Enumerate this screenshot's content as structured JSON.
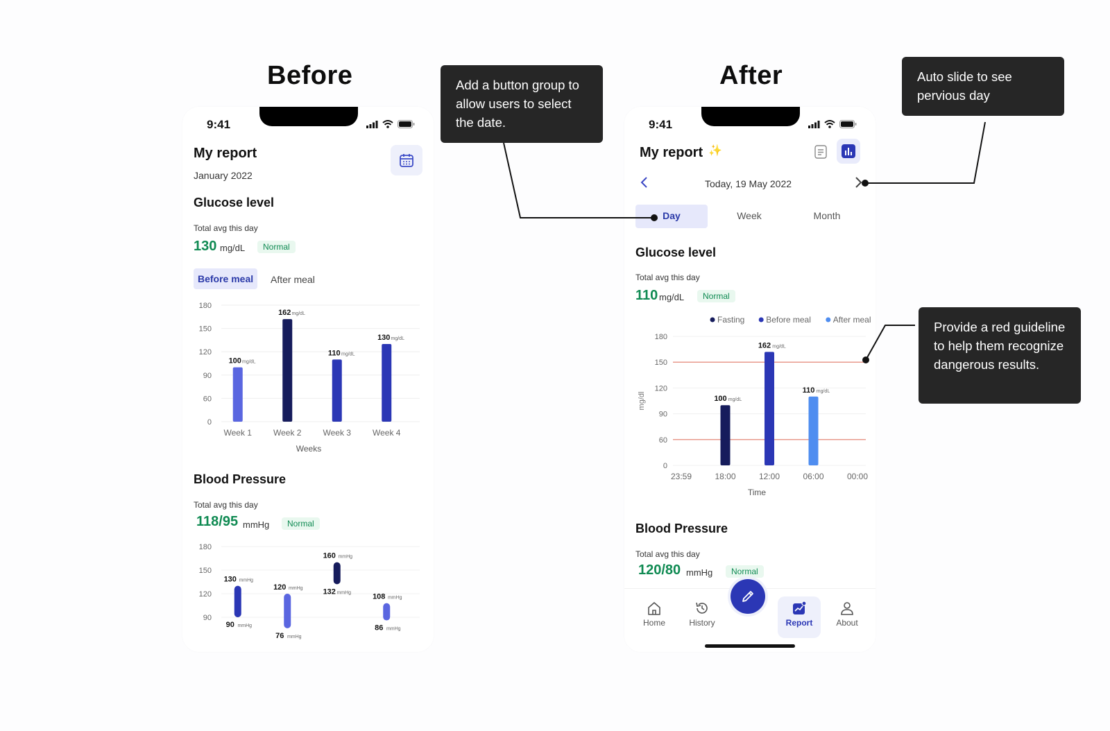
{
  "headings": {
    "before": "Before",
    "after": "After"
  },
  "callouts": {
    "date_group": "Add a button group to allow users to select the date.",
    "auto_slide": "Auto slide to see pervious day",
    "red_guideline": "Provide a red guideline to help them recognize dangerous results."
  },
  "before": {
    "status_time": "9:41",
    "title": "My report",
    "date": "January 2022",
    "glucose": {
      "title": "Glucose level",
      "avg_label": "Total avg this day",
      "value": "130",
      "unit": "mg/dL",
      "status": "Normal",
      "tabs": [
        "Before meal",
        "After meal"
      ]
    },
    "blood_pressure": {
      "title": "Blood Pressure",
      "avg_label": "Total avg this day",
      "value": "118/95",
      "unit": "mmHg",
      "status": "Normal"
    }
  },
  "after": {
    "status_time": "9:41",
    "title": "My report",
    "sparkle": "✨",
    "date_nav": {
      "label": "Today, 19 May 2022"
    },
    "segments": [
      "Day",
      "Week",
      "Month"
    ],
    "glucose": {
      "title": "Glucose level",
      "avg_label": "Total avg this day",
      "value": "110",
      "unit": "mg/dL",
      "status": "Normal"
    },
    "blood_pressure": {
      "title": "Blood Pressure",
      "avg_label": "Total avg this day",
      "value": "120/80",
      "unit": "mmHg",
      "status": "Normal"
    },
    "nav": [
      "Home",
      "History",
      "Report",
      "About"
    ]
  },
  "colors": {
    "navy": "#161c5c",
    "indigo": "#2b37b5",
    "periwinkle": "#5a66e0",
    "sky": "#4f8df0",
    "green": "#0f8a52",
    "guideline": "#e89a8c"
  },
  "chart_data": [
    {
      "type": "bar",
      "xlabel": "Weeks",
      "ylim": [
        0,
        180
      ],
      "yticks": [
        0,
        60,
        90,
        120,
        150,
        180
      ],
      "categories": [
        "Week 1",
        "Week 2",
        "Week 3",
        "Week 4"
      ],
      "values": [
        100,
        162,
        110,
        130
      ],
      "value_unit": "mg/dL",
      "bar_colors": [
        "#5a66e0",
        "#161c5c",
        "#2b37b5",
        "#2b37b5"
      ],
      "grid": true
    },
    {
      "type": "bar",
      "xlabel": "Time",
      "ylabel": "mg/dl",
      "ylim": [
        0,
        180
      ],
      "yticks": [
        0,
        60,
        90,
        120,
        150,
        180
      ],
      "categories": [
        "23:59",
        "18:00",
        "12:00",
        "06:00",
        "00:00"
      ],
      "legend": [
        "Fasting",
        "Before meal",
        "After meal"
      ],
      "legend_colors": [
        "#161c5c",
        "#2b37b5",
        "#4f8df0"
      ],
      "legend_position": "top-right",
      "bars": [
        {
          "series": "Fasting",
          "category": "18:00",
          "value": 100
        },
        {
          "series": "Before meal",
          "category": "12:00",
          "value": 162
        },
        {
          "series": "After meal",
          "category": "06:00",
          "value": 110
        }
      ],
      "value_unit": "mg/dL",
      "guidelines": [
        150,
        60
      ],
      "grid": true
    },
    {
      "type": "range-bar",
      "ylim": [
        90,
        180
      ],
      "yticks": [
        90,
        120,
        150,
        180
      ],
      "ranges": [
        {
          "high": 130,
          "low": 90
        },
        {
          "high": 120,
          "low": 76
        },
        {
          "high": 160,
          "low": 132
        },
        {
          "high": 108,
          "low": 86
        }
      ],
      "value_unit": "mmHg",
      "bar_colors": [
        "#2b37b5",
        "#5a66e0",
        "#161c5c",
        "#5a66e0"
      ]
    }
  ]
}
